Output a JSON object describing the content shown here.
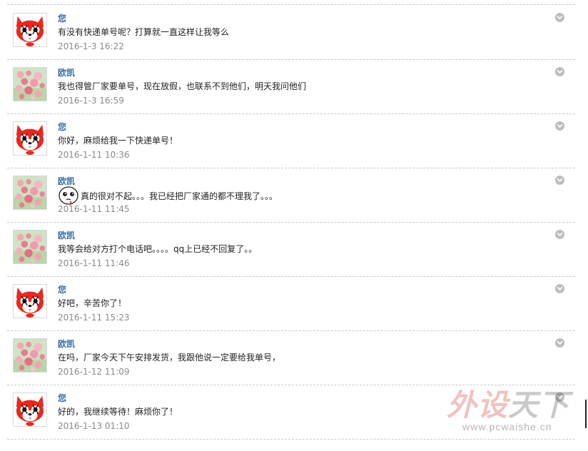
{
  "colors": {
    "sender": "#3a6ea5",
    "text": "#222222",
    "time": "#8a8a8a",
    "divider": "#c9c9c9",
    "menu_button": "#bdbdbd"
  },
  "icons": {
    "customer_avatar": "red-fox-cartoon-avatar",
    "seller_avatar": "pink-flowers-avatar",
    "menu": "chevron-down-circle-icon",
    "emoji": "crying-face-emoji"
  },
  "messages": [
    {
      "sender": "您",
      "avatar": "fox",
      "text": "有没有快递单号呢？打算就一直这样让我等么",
      "time": "2016-1-3 16:22"
    },
    {
      "sender": "欧凯",
      "avatar": "flowers",
      "text": "我也得管厂家要单号，现在放假，也联系不到他们，明天我问他们",
      "time": "2016-1-3 16:59"
    },
    {
      "sender": "您",
      "avatar": "fox",
      "text": "你好，麻烦给我一下快递单号！",
      "time": "2016-1-11 10:36"
    },
    {
      "sender": "欧凯",
      "avatar": "flowers",
      "text": "真的很对不起。。。我已经把厂家通的都不理我了。。。",
      "time": "2016-1-11 11:45",
      "emoji": true
    },
    {
      "sender": "欧凯",
      "avatar": "flowers",
      "text": "我等会给对方打个电话吧。。。。qq上已经不回复了。。",
      "time": "2016-1-11 11:46"
    },
    {
      "sender": "您",
      "avatar": "fox",
      "text": "好吧，辛苦你了！",
      "time": "2016-1-11 15:23"
    },
    {
      "sender": "欧凯",
      "avatar": "flowers",
      "text": "在吗，厂家今天下午安排发货，我跟他说一定要给我单号，",
      "time": "2016-1-12 11:09"
    },
    {
      "sender": "您",
      "avatar": "fox",
      "text": "好的，我继续等待！麻烦你了！",
      "time": "2016-1-13 01:10"
    }
  ],
  "watermark": {
    "main_red": "外设",
    "main_dark": "天下",
    "url": "www.pcwaishe.cn"
  }
}
